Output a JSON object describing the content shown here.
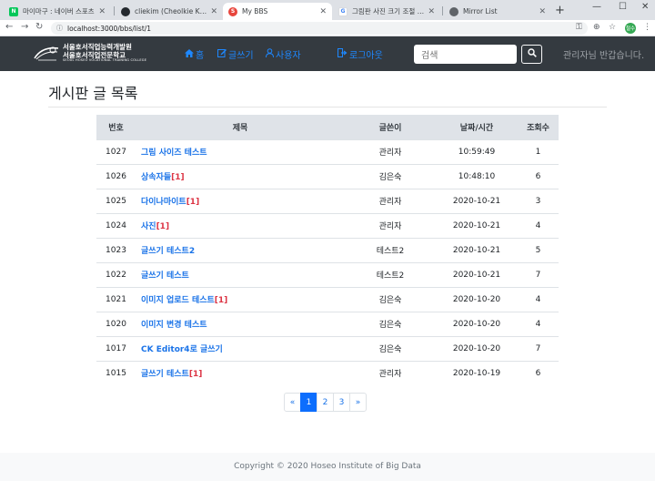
{
  "browser": {
    "tabs": [
      {
        "title": "마이마구 : 네이버 스포츠",
        "favicon_color": "#03c75a",
        "favicon_glyph": "N"
      },
      {
        "title": "cliekim (Cheolkie Kim)",
        "favicon_color": "#24292e",
        "favicon_glyph": "●"
      },
      {
        "title": "My BBS",
        "favicon_color": "#e8453c",
        "favicon_glyph": "S"
      },
      {
        "title": "그림판 사진 크기 조절 - Google",
        "favicon_color": "#4285f4",
        "favicon_glyph": "G"
      },
      {
        "title": "Mirror List",
        "favicon_color": "#5f6368",
        "favicon_glyph": "◎"
      }
    ],
    "url": "localhost:3000/bbs/list/1",
    "profile_initial": "철수"
  },
  "site": {
    "logo_line1": "서울호서직업능력개발원",
    "logo_line2": "서울호서직업전문학교",
    "logo_line3": "SEOUL HOSEO VOCATIONAL TRAINING COLLEGE",
    "nav": {
      "home": "홈",
      "write": "글쓰기",
      "users": "사용자",
      "logout": "로그아웃"
    },
    "search_placeholder": "검색",
    "greeting": "관리자님 반갑습니다."
  },
  "page_title": "게시판 글 목록",
  "table": {
    "headers": {
      "no": "번호",
      "title": "제목",
      "author": "글쓴이",
      "date": "날짜/시간",
      "views": "조회수"
    },
    "rows": [
      {
        "no": "1027",
        "title": "그림 사이즈 테스트",
        "comments": "",
        "author": "관리자",
        "date": "10:59:49",
        "views": "1"
      },
      {
        "no": "1026",
        "title": "상속자들",
        "comments": "[1]",
        "author": "김은숙",
        "date": "10:48:10",
        "views": "6"
      },
      {
        "no": "1025",
        "title": "다이나마이트",
        "comments": "[1]",
        "author": "관리자",
        "date": "2020-10-21",
        "views": "3"
      },
      {
        "no": "1024",
        "title": "사진",
        "comments": "[1]",
        "author": "관리자",
        "date": "2020-10-21",
        "views": "4"
      },
      {
        "no": "1023",
        "title": "글쓰기 테스트2",
        "comments": "",
        "author": "테스트2",
        "date": "2020-10-21",
        "views": "5"
      },
      {
        "no": "1022",
        "title": "글쓰기 테스트",
        "comments": "",
        "author": "테스트2",
        "date": "2020-10-21",
        "views": "7"
      },
      {
        "no": "1021",
        "title": "이미지 업로드 테스트",
        "comments": "[1]",
        "author": "김은숙",
        "date": "2020-10-20",
        "views": "4"
      },
      {
        "no": "1020",
        "title": "이미지 변경 테스트",
        "comments": "",
        "author": "김은숙",
        "date": "2020-10-20",
        "views": "4"
      },
      {
        "no": "1017",
        "title": "CK Editor4로 글쓰기",
        "comments": "",
        "author": "김은숙",
        "date": "2020-10-20",
        "views": "7"
      },
      {
        "no": "1015",
        "title": "글쓰기 테스트",
        "comments": "[1]",
        "author": "관리자",
        "date": "2020-10-19",
        "views": "6"
      }
    ]
  },
  "pagination": {
    "prev": "«",
    "pages": [
      "1",
      "2",
      "3"
    ],
    "current": "1",
    "next": "»"
  },
  "footer": "Copyright © 2020 Hoseo Institute of Big Data",
  "colors": {
    "navbar": "#343a40",
    "link": "#1a73e8",
    "comment_count": "#dc3545",
    "active_page": "#0d6efd"
  }
}
